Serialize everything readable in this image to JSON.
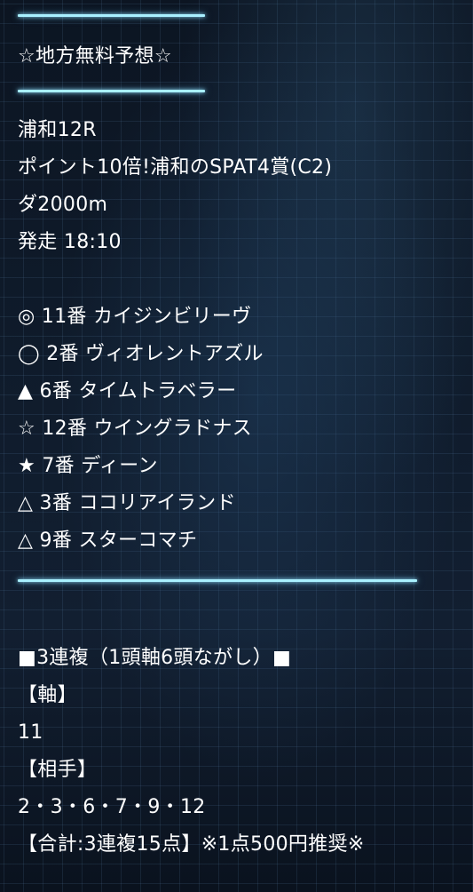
{
  "header": {
    "title": "☆地方無料予想☆"
  },
  "race": {
    "venue_round": "浦和12R",
    "name": "ポイント10倍!浦和のSPAT4賞(C2)",
    "course": "ダ2000m",
    "start": "発走 18:10"
  },
  "picks": [
    {
      "mark": "◎",
      "num": "11番",
      "horse": "カイジンビリーヴ"
    },
    {
      "mark": "◯",
      "num": "2番",
      "horse": "ヴィオレントアズル"
    },
    {
      "mark": "▲",
      "num": "6番",
      "horse": "タイムトラベラー"
    },
    {
      "mark": "☆",
      "num": "12番",
      "horse": "ウイングラドナス"
    },
    {
      "mark": "★",
      "num": "7番",
      "horse": "ディーン"
    },
    {
      "mark": "△",
      "num": "3番",
      "horse": "ココリアイランド"
    },
    {
      "mark": "△",
      "num": "9番",
      "horse": "スターコマチ"
    }
  ],
  "bet": {
    "type_label": "■3連複（1頭軸6頭ながし）■",
    "axis_label": "【軸】",
    "axis_value": "11",
    "partner_label": "【相手】",
    "partner_value": "2・3・6・7・9・12",
    "total_label": "【合計:3連複15点】※1点500円推奨※"
  }
}
